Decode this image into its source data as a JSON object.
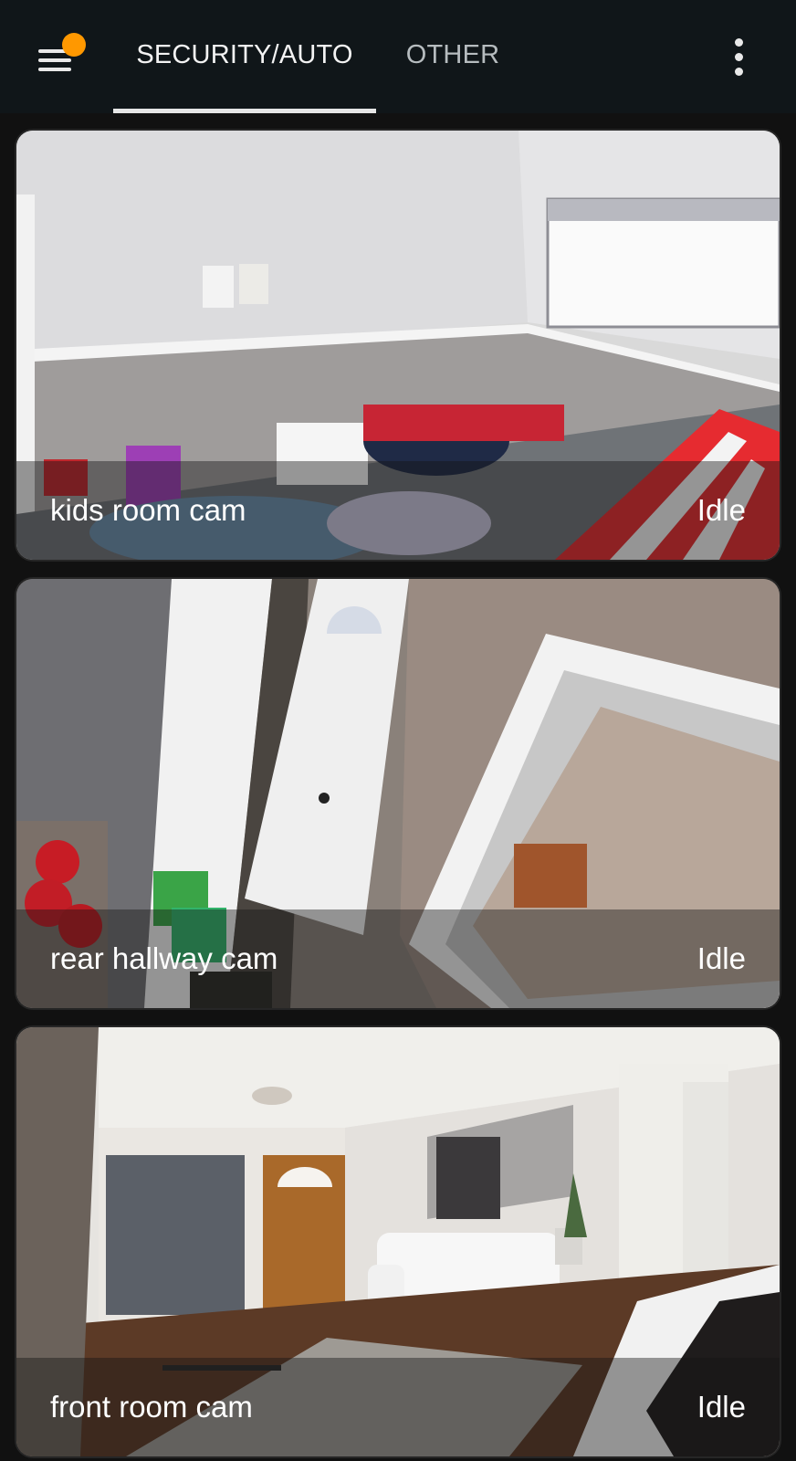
{
  "header": {
    "tabs": [
      {
        "label": "SECURITY/AUTO",
        "selected": true
      },
      {
        "label": "OTHER",
        "selected": false
      }
    ],
    "menu_icon": "hamburger-menu-icon",
    "notification_color": "#ff9800",
    "overflow_icon": "more-vertical-icon"
  },
  "cameras": [
    {
      "name": "kids room cam",
      "state": "Idle"
    },
    {
      "name": "rear hallway cam",
      "state": "Idle"
    },
    {
      "name": "front room cam",
      "state": "Idle"
    }
  ]
}
